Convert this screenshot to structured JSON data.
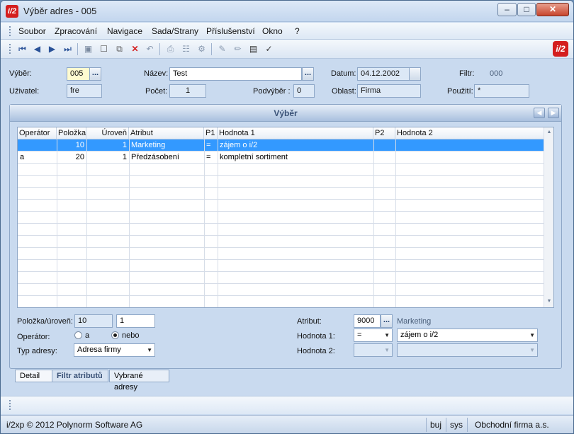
{
  "window": {
    "title": "Výběr adres - 005",
    "logo": "i/2"
  },
  "menu": [
    "Soubor",
    "Zpracování",
    "Navigace",
    "Sada/Strany",
    "Příslušenství",
    "Okno",
    "?"
  ],
  "toolbar_icons": [
    "first-record-icon",
    "previous-record-icon",
    "next-record-icon",
    "last-record-icon",
    "save-icon",
    "new-icon",
    "copy-icon",
    "delete-icon",
    "undo-icon",
    "print-icon",
    "structure-icon",
    "settings-icon",
    "edit-icon",
    "edit-alt-icon",
    "import-icon",
    "filter-icon"
  ],
  "header": {
    "vyber_label": "Výběr:",
    "vyber_value": "005",
    "nazev_label": "Název:",
    "nazev_value": "Test",
    "datum_label": "Datum:",
    "datum_value": "04.12.2002",
    "filtr_label": "Filtr:",
    "filtr_value": "000",
    "uzivatel_label": "Uživatel:",
    "uzivatel_value": "fre",
    "pocet_label": "Počet:",
    "pocet_value": "1",
    "podvyber_label": "Podvýběr :",
    "podvyber_value": "0",
    "oblast_label": "Oblast:",
    "oblast_value": "Firma",
    "pouziti_label": "Použití:",
    "pouziti_value": "*",
    "dots": "..."
  },
  "panel": {
    "title": "Výběr"
  },
  "grid": {
    "columns": [
      "Operátor",
      "Položka",
      "Úroveň",
      "Atribut",
      "P1",
      "Hodnota 1",
      "P2",
      "Hodnota 2"
    ],
    "rows": [
      {
        "operator": "",
        "polozka": "10",
        "uroven": "1",
        "atribut": "Marketing",
        "p1": "=",
        "hodnota1": "zájem o i/2",
        "p2": "",
        "hodnota2": ""
      },
      {
        "operator": "a",
        "polozka": "20",
        "uroven": "1",
        "atribut": "Předzásobení",
        "p1": "=",
        "hodnota1": "kompletní sortiment",
        "p2": "",
        "hodnota2": ""
      }
    ]
  },
  "detail": {
    "polozka_label": "Položka/úroveň:",
    "polozka_value": "10",
    "uroven_value": "1",
    "operator_label": "Operátor:",
    "opt_a": "a",
    "opt_nebo": "nebo",
    "operator_selected": "nebo",
    "typ_label": "Typ adresy:",
    "typ_value": "Adresa firmy",
    "atribut_label": "Atribut:",
    "atribut_code": "9000",
    "atribut_name": "Marketing",
    "hodnota1_label": "Hodnota 1:",
    "hodnota1_op": "=",
    "hodnota1_value": "zájem o i/2",
    "hodnota2_label": "Hodnota 2:",
    "hodnota2_op": "",
    "hodnota2_value": ""
  },
  "tabs": [
    "Detail",
    "Filtr atributů",
    "Vybrané adresy"
  ],
  "status": {
    "copyright": "i/2xp © 2012 Polynorm Software AG",
    "user": "buj",
    "system": "sys",
    "company": "Obchodní firma a.s."
  }
}
